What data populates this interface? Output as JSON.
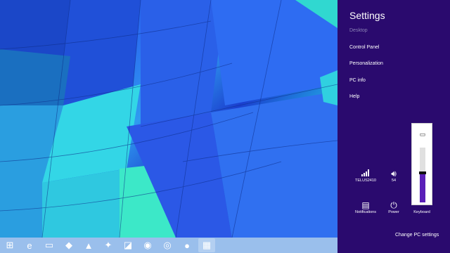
{
  "charms": {
    "title": "Settings",
    "items": [
      {
        "label": "Desktop",
        "dim": true
      },
      {
        "label": "Control Panel",
        "dim": false
      },
      {
        "label": "Personalization",
        "dim": false
      },
      {
        "label": "PC info",
        "dim": false
      },
      {
        "label": "Help",
        "dim": false
      }
    ],
    "status": {
      "network": {
        "icon": "signal-bars-icon",
        "label": "TELUS2410"
      },
      "volume": {
        "icon": "speaker-icon",
        "label": "54"
      },
      "notifications": {
        "icon": "notifications-icon",
        "label": "Notifications"
      },
      "power": {
        "icon": "power-icon",
        "label": "Power"
      },
      "keyboard": {
        "icon": "keyboard-icon",
        "label": "Keyboard"
      }
    },
    "volume_level": 0.54,
    "change_pc_settings": "Change PC settings"
  },
  "taskbar": {
    "items": [
      {
        "name": "start-button",
        "glyph": "⊞"
      },
      {
        "name": "internet-explorer-icon",
        "glyph": "e"
      },
      {
        "name": "file-explorer-icon",
        "glyph": "▭"
      },
      {
        "name": "app-icon-1",
        "glyph": "◆"
      },
      {
        "name": "app-icon-2",
        "glyph": "▲"
      },
      {
        "name": "app-icon-3",
        "glyph": "✦"
      },
      {
        "name": "app-icon-4",
        "glyph": "◪"
      },
      {
        "name": "steam-icon",
        "glyph": "◉"
      },
      {
        "name": "chrome-icon",
        "glyph": "◎"
      },
      {
        "name": "firefox-icon",
        "glyph": "●"
      },
      {
        "name": "store-icon",
        "glyph": "▦"
      }
    ]
  },
  "colors": {
    "charms_bg": "#2a0a6e",
    "accent": "#5a1fb8"
  }
}
